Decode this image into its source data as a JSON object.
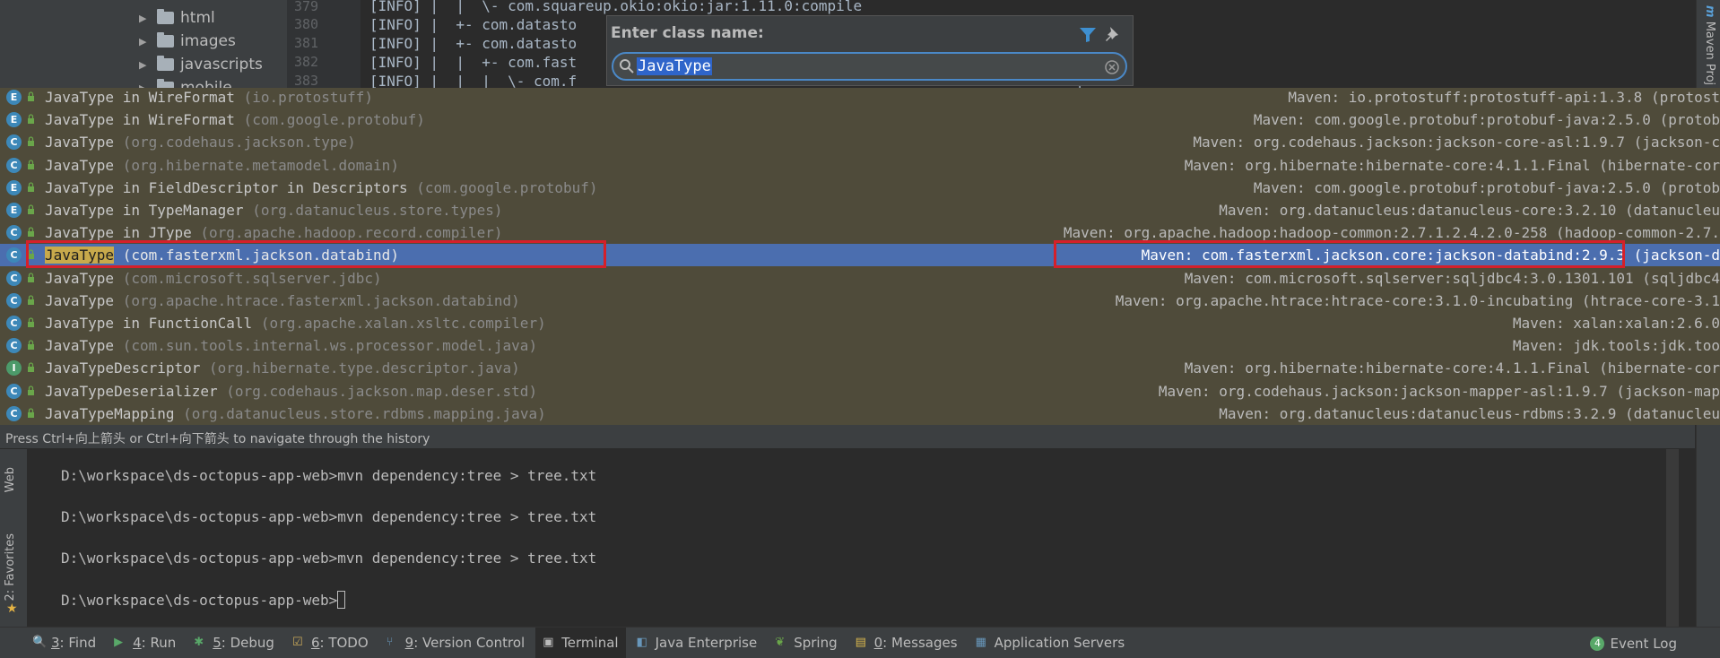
{
  "project_tree": {
    "items": [
      {
        "label": "html"
      },
      {
        "label": "images"
      },
      {
        "label": "javascripts"
      },
      {
        "label": "mobile"
      }
    ]
  },
  "editor": {
    "line_numbers": [
      "379",
      "380",
      "381",
      "382",
      "383"
    ],
    "lines": [
      "[INFO] |  |  \\- com.squareup.okio:okio:jar:1.11.0:compile",
      "[INFO] |  +- com.datasto",
      "[INFO] |  +- com.datasto",
      "[INFO] |  |  +- com.fast",
      "[INFO] |  |  |  \\- com.f                                                        ompile"
    ]
  },
  "right_panel": {
    "maven_tab": "Maven Proj"
  },
  "popup": {
    "title": "Enter class name:",
    "input_value": "JavaType"
  },
  "results": [
    {
      "icon": "E",
      "name": "JavaType",
      "suffix": " in WireFormat",
      "pkg": " (io.protostuff)",
      "location": "Maven: io.protostuff:protostuff-api:1.3.8 (protost"
    },
    {
      "icon": "E",
      "name": "JavaType",
      "suffix": " in WireFormat",
      "pkg": " (com.google.protobuf)",
      "location": "Maven: com.google.protobuf:protobuf-java:2.5.0 (protob"
    },
    {
      "icon": "C",
      "name": "JavaType",
      "suffix": "",
      "pkg": " (org.codehaus.jackson.type)",
      "location": "Maven: org.codehaus.jackson:jackson-core-asl:1.9.7 (jackson-c"
    },
    {
      "icon": "C",
      "name": "JavaType",
      "suffix": "",
      "pkg": " (org.hibernate.metamodel.domain)",
      "location": "Maven: org.hibernate:hibernate-core:4.1.1.Final (hibernate-cor"
    },
    {
      "icon": "E",
      "name": "JavaType",
      "suffix": " in FieldDescriptor in Descriptors",
      "pkg": " (com.google.protobuf)",
      "location": "Maven: com.google.protobuf:protobuf-java:2.5.0 (protob"
    },
    {
      "icon": "E",
      "name": "JavaType",
      "suffix": " in TypeManager",
      "pkg": " (org.datanucleus.store.types)",
      "location": "Maven: org.datanucleus:datanucleus-core:3.2.10 (datanucleu"
    },
    {
      "icon": "C",
      "name": "JavaType",
      "suffix": " in JType",
      "pkg": " (org.apache.hadoop.record.compiler)",
      "location": "Maven: org.apache.hadoop:hadoop-common:2.7.1.2.4.2.0-258 (hadoop-common-2.7."
    },
    {
      "icon": "C",
      "name": "JavaType",
      "suffix": "",
      "pkg": " (com.fasterxml.jackson.databind)",
      "location": "Maven: com.fasterxml.jackson.core:jackson-databind:2.9.3",
      "location_tail": " (jackson-d",
      "selected": true
    },
    {
      "icon": "C",
      "name": "JavaType",
      "suffix": "",
      "pkg": " (com.microsoft.sqlserver.jdbc)",
      "location": "Maven: com.microsoft.sqlserver:sqljdbc4:3.0.1301.101 (sqljdbc4"
    },
    {
      "icon": "C",
      "name": "JavaType",
      "suffix": "",
      "pkg": " (org.apache.htrace.fasterxml.jackson.databind)",
      "location": "Maven: org.apache.htrace:htrace-core:3.1.0-incubating (htrace-core-3.1"
    },
    {
      "icon": "C",
      "name": "JavaType",
      "suffix": " in FunctionCall",
      "pkg": " (org.apache.xalan.xsltc.compiler)",
      "location": "Maven: xalan:xalan:2.6.0"
    },
    {
      "icon": "C",
      "name": "JavaType",
      "suffix": "",
      "pkg": " (com.sun.tools.internal.ws.processor.model.java)",
      "location": "Maven: jdk.tools:jdk.too"
    },
    {
      "icon": "I",
      "name": "JavaTypeDescriptor",
      "suffix": "",
      "pkg": " (org.hibernate.type.descriptor.java)",
      "location": "Maven: org.hibernate:hibernate-core:4.1.1.Final (hibernate-cor"
    },
    {
      "icon": "C",
      "name": "JavaTypeDeserializer",
      "suffix": "",
      "pkg": " (org.codehaus.jackson.map.deser.std)",
      "location": "Maven: org.codehaus.jackson:jackson-mapper-asl:1.9.7 (jackson-map"
    },
    {
      "icon": "C",
      "name": "JavaTypeMapping",
      "suffix": "",
      "pkg": " (org.datanucleus.store.rdbms.mapping.java)",
      "location": "Maven: org.datanucleus:datanucleus-rdbms:3.2.9 (datanucleu"
    }
  ],
  "hint": "Press Ctrl+向上箭头 or Ctrl+向下箭头 to navigate through the history",
  "terminal": {
    "lines": [
      "D:\\workspace\\ds-octopus-app-web>mvn dependency:tree > tree.txt",
      "D:\\workspace\\ds-octopus-app-web>mvn dependency:tree > tree.txt",
      "D:\\workspace\\ds-octopus-app-web>mvn dependency:tree > tree.txt",
      "D:\\workspace\\ds-octopus-app-web>"
    ]
  },
  "left_tabs": {
    "web": "Web",
    "favorites": "2: Favorites"
  },
  "bottom_bar": {
    "tabs": [
      {
        "num": "3",
        "label": ": Find",
        "icon": "search-icon"
      },
      {
        "num": "4",
        "label": ": Run",
        "icon": "run-icon"
      },
      {
        "num": "5",
        "label": ": Debug",
        "icon": "debug-icon"
      },
      {
        "num": "6",
        "label": ": TODO",
        "icon": "todo-icon"
      },
      {
        "num": "9",
        "label": ": Version Control",
        "icon": "vcs-icon"
      },
      {
        "num": "",
        "label": "Terminal",
        "icon": "terminal-icon",
        "active": true
      },
      {
        "num": "",
        "label": "Java Enterprise",
        "icon": "java-enterprise-icon"
      },
      {
        "num": "",
        "label": "Spring",
        "icon": "spring-icon"
      },
      {
        "num": "0",
        "label": ": Messages",
        "icon": "messages-icon"
      },
      {
        "num": "",
        "label": "Application Servers",
        "icon": "app-servers-icon"
      }
    ],
    "event_log": {
      "badge": "4",
      "label": "Event Log"
    }
  },
  "colors": {
    "selection": "#4b6eaf",
    "results_bg": "#4f4b3a",
    "highlight": "#c8a94b",
    "annotation_box": "#d5202a"
  }
}
